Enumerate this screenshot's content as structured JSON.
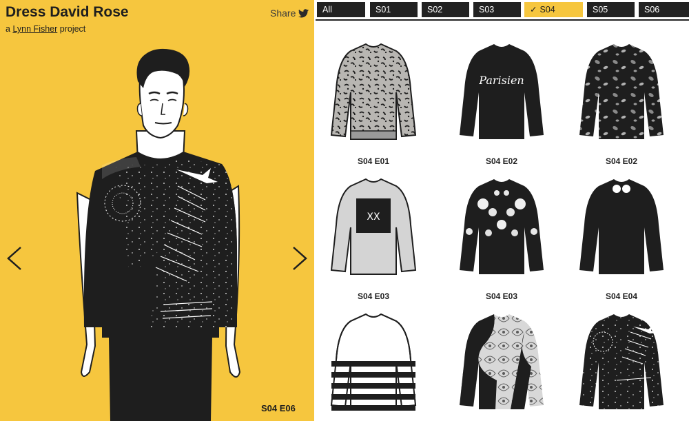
{
  "header": {
    "title": "Dress David Rose",
    "byline_prefix": "a ",
    "byline_link": "Lynn Fisher",
    "byline_suffix": " project",
    "share_label": "Share"
  },
  "current": {
    "episode": "S04 E06"
  },
  "filters": [
    {
      "label": "All",
      "active": false
    },
    {
      "label": "S01",
      "active": false
    },
    {
      "label": "S02",
      "active": false
    },
    {
      "label": "S03",
      "active": false
    },
    {
      "label": "S04",
      "active": true
    },
    {
      "label": "S05",
      "active": false
    },
    {
      "label": "S06",
      "active": false
    }
  ],
  "gallery": [
    {
      "label": "S04 E01",
      "pattern": "leopard-print"
    },
    {
      "label": "S04 E02",
      "pattern": "parisien",
      "print_text": "Parisien"
    },
    {
      "label": "S04 E02",
      "pattern": "grey-spots"
    },
    {
      "label": "S04 E03",
      "pattern": "grey-square-graphic",
      "print_text": "XX"
    },
    {
      "label": "S04 E03",
      "pattern": "white-floral"
    },
    {
      "label": "S04 E04",
      "pattern": "black-with-sunglasses"
    },
    {
      "label": "",
      "pattern": "horizontal-stripes"
    },
    {
      "label": "",
      "pattern": "paisley-patchwork"
    },
    {
      "label": "",
      "pattern": "bird-lyrics-print"
    }
  ],
  "colors": {
    "accent": "#f6c63e",
    "dark": "#222222"
  },
  "icons": {
    "share": "twitter-bird-icon",
    "prev": "chevron-left-icon",
    "next": "chevron-right-icon",
    "selected": "checkmark-icon"
  }
}
